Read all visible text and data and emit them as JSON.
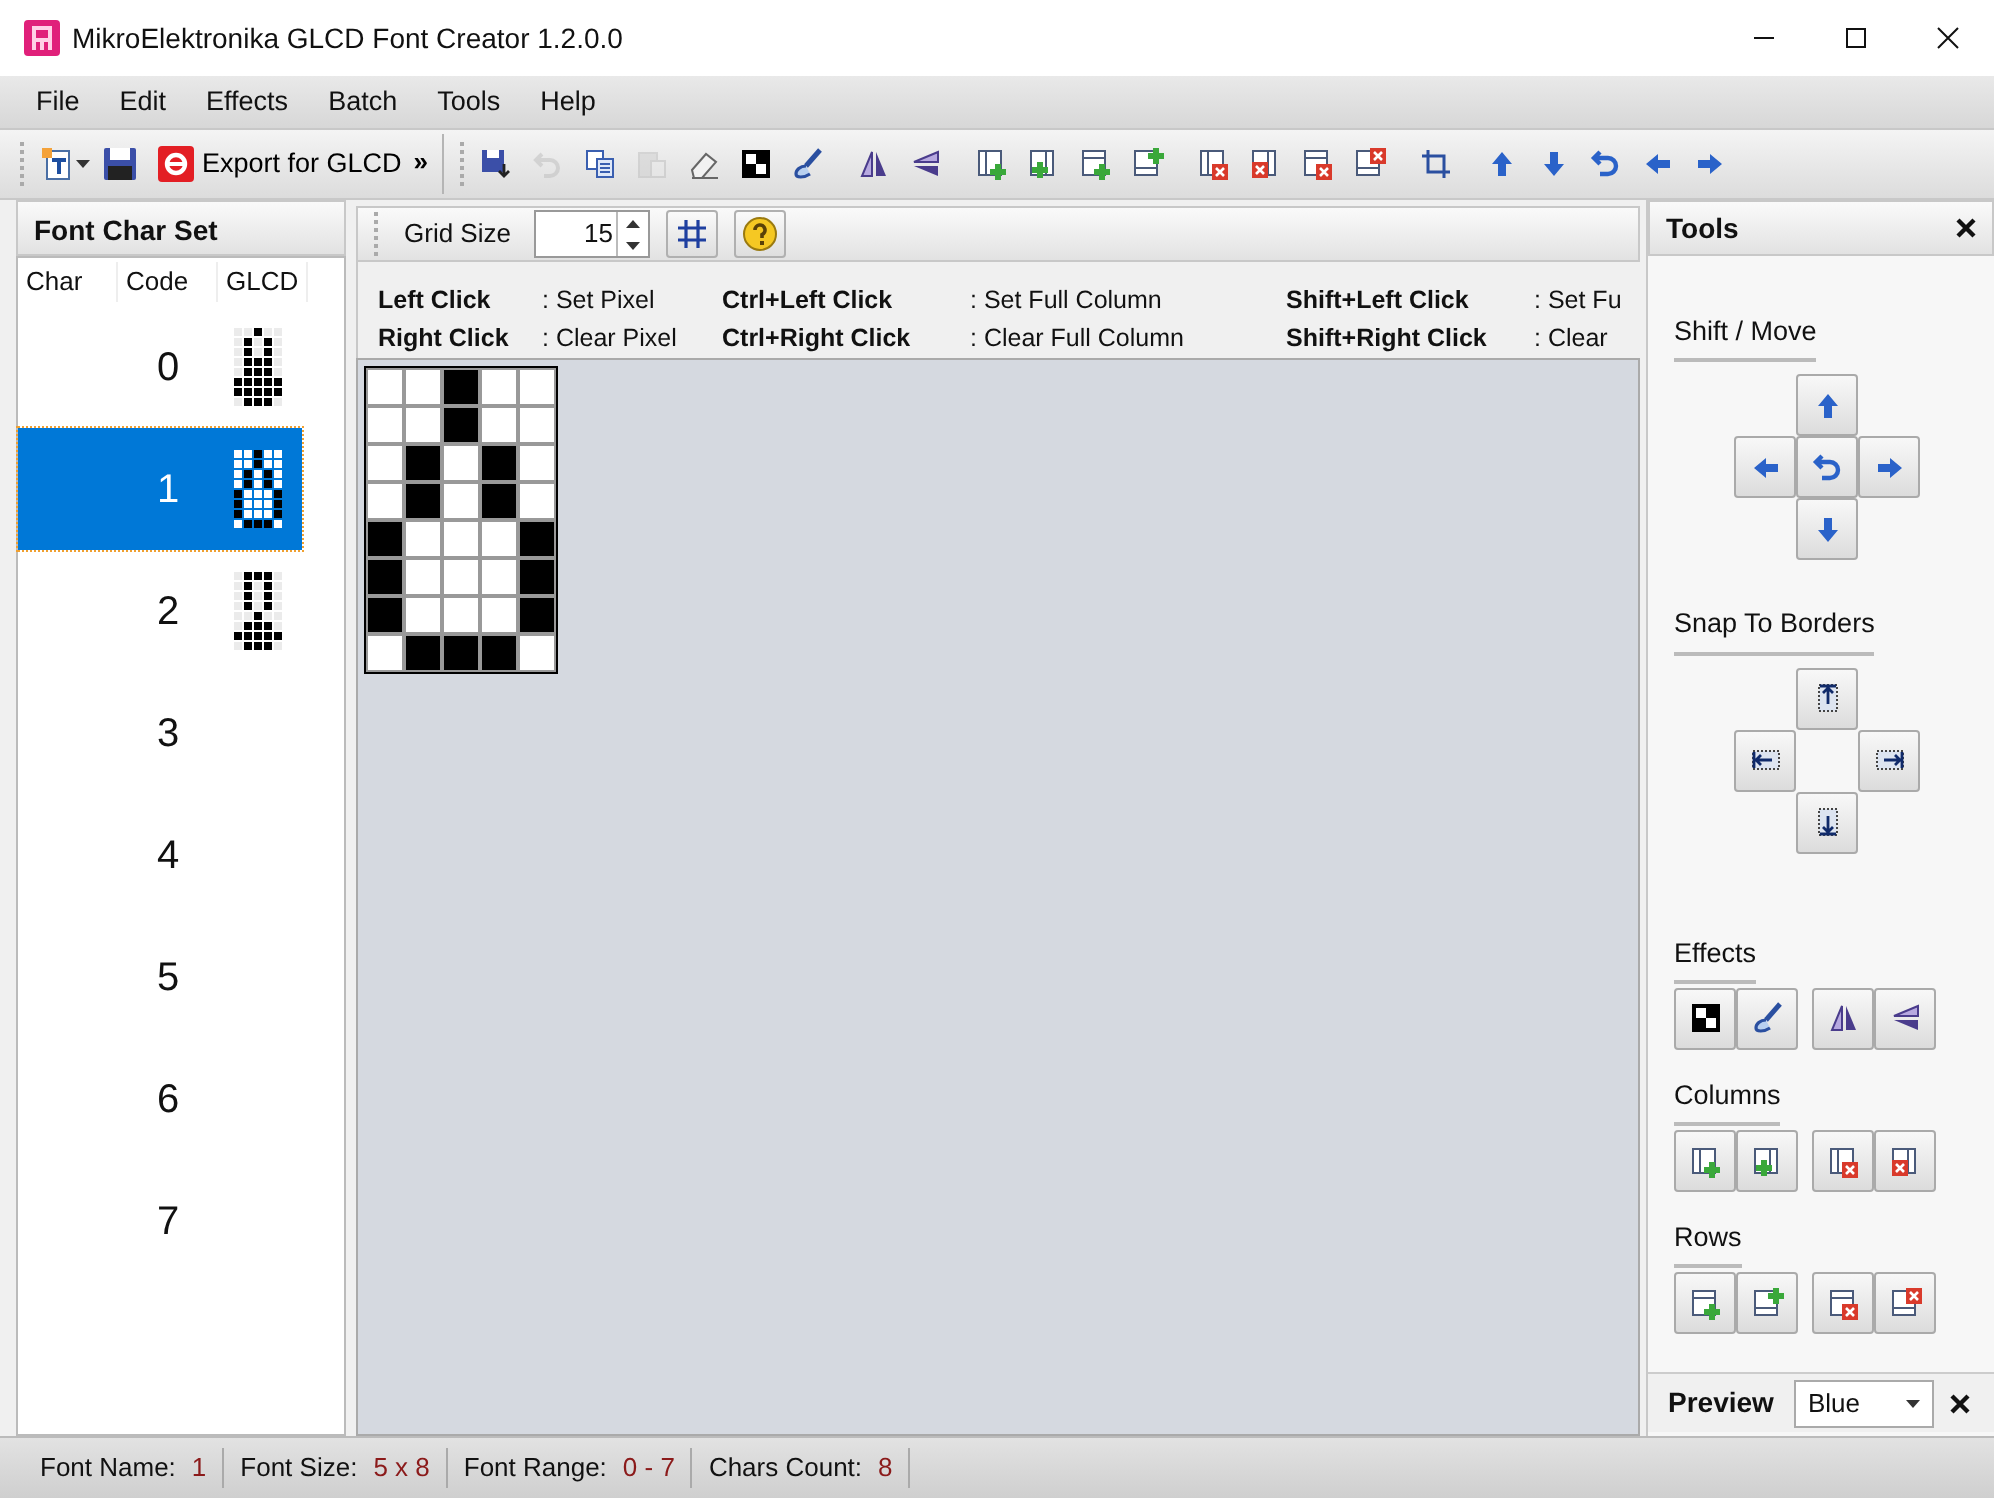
{
  "window": {
    "title": "MikroElektronika GLCD Font Creator 1.2.0.0"
  },
  "menu": [
    "File",
    "Edit",
    "Effects",
    "Batch",
    "Tools",
    "Help"
  ],
  "toolbar": {
    "export_label": "Export for GLCD",
    "overflow": "»",
    "button_groups": [
      [
        {
          "kind": "save-as",
          "disabled": false
        },
        {
          "kind": "undo",
          "disabled": true
        },
        {
          "kind": "copy",
          "disabled": false
        },
        {
          "kind": "paste",
          "disabled": true
        },
        {
          "kind": "eraser",
          "disabled": false
        },
        {
          "kind": "invert",
          "disabled": false
        },
        {
          "kind": "brush",
          "disabled": false
        }
      ],
      [
        {
          "kind": "mirror",
          "disabled": false
        },
        {
          "kind": "flip",
          "disabled": false
        }
      ],
      [
        {
          "kind": "col-add-left",
          "disabled": false
        },
        {
          "kind": "col-add-right",
          "disabled": false
        },
        {
          "kind": "row-add-bottom",
          "disabled": false
        },
        {
          "kind": "row-add-top",
          "disabled": false
        }
      ],
      [
        {
          "kind": "col-del-left",
          "disabled": false
        },
        {
          "kind": "col-del-right",
          "disabled": false
        },
        {
          "kind": "row-del-bottom",
          "disabled": false
        },
        {
          "kind": "row-del-top",
          "disabled": false
        }
      ],
      [
        {
          "kind": "crop",
          "disabled": false
        }
      ],
      [
        {
          "kind": "up",
          "disabled": false
        },
        {
          "kind": "down",
          "disabled": false
        },
        {
          "kind": "rotate",
          "disabled": false
        },
        {
          "kind": "left",
          "disabled": false
        },
        {
          "kind": "right",
          "disabled": false
        }
      ]
    ]
  },
  "charset": {
    "title": "Font Char Set",
    "columns": [
      "Char",
      "Code",
      "GLCD"
    ],
    "rows": [
      {
        "code": "0",
        "selected": false,
        "pixels": [
          [
            false,
            false,
            true,
            false,
            false
          ],
          [
            false,
            true,
            false,
            true,
            false
          ],
          [
            false,
            true,
            false,
            true,
            false
          ],
          [
            false,
            true,
            true,
            true,
            false
          ],
          [
            false,
            true,
            true,
            true,
            false
          ],
          [
            true,
            true,
            true,
            true,
            true
          ],
          [
            true,
            true,
            true,
            true,
            true
          ],
          [
            false,
            true,
            true,
            true,
            false
          ]
        ]
      },
      {
        "code": "1",
        "selected": true,
        "pixels": [
          [
            false,
            false,
            true,
            false,
            false
          ],
          [
            false,
            false,
            true,
            false,
            false
          ],
          [
            false,
            true,
            false,
            true,
            false
          ],
          [
            false,
            true,
            false,
            true,
            false
          ],
          [
            true,
            false,
            false,
            false,
            true
          ],
          [
            true,
            false,
            false,
            false,
            true
          ],
          [
            true,
            false,
            false,
            false,
            true
          ],
          [
            false,
            true,
            true,
            true,
            false
          ]
        ]
      },
      {
        "code": "2",
        "selected": false,
        "pixels": [
          [
            false,
            true,
            true,
            true,
            false
          ],
          [
            false,
            true,
            false,
            true,
            false
          ],
          [
            false,
            true,
            false,
            true,
            false
          ],
          [
            false,
            true,
            false,
            true,
            false
          ],
          [
            false,
            false,
            true,
            false,
            false
          ],
          [
            false,
            true,
            true,
            true,
            false
          ],
          [
            true,
            true,
            true,
            true,
            true
          ],
          [
            false,
            true,
            true,
            true,
            false
          ]
        ]
      },
      {
        "code": "3",
        "selected": false
      },
      {
        "code": "4",
        "selected": false
      },
      {
        "code": "5",
        "selected": false
      },
      {
        "code": "6",
        "selected": false
      },
      {
        "code": "7",
        "selected": false
      }
    ]
  },
  "editor": {
    "grid_size_label": "Grid Size",
    "grid_size": "15",
    "hints": [
      [
        {
          "key": "Left Click",
          "action": ": Set Pixel"
        },
        {
          "key": "Right Click",
          "action": ": Clear Pixel"
        }
      ],
      [
        {
          "key": "Ctrl+Left Click",
          "action": ": Set Full Column"
        },
        {
          "key": "Ctrl+Right Click",
          "action": ": Clear Full Column"
        }
      ],
      [
        {
          "key": "Shift+Left Click",
          "action": ": Set Fu"
        },
        {
          "key": "Shift+Right Click",
          "action": ": Clear"
        }
      ]
    ],
    "pixels": [
      [
        false,
        false,
        true,
        false,
        false
      ],
      [
        false,
        false,
        true,
        false,
        false
      ],
      [
        false,
        true,
        false,
        true,
        false
      ],
      [
        false,
        true,
        false,
        true,
        false
      ],
      [
        true,
        false,
        false,
        false,
        true
      ],
      [
        true,
        false,
        false,
        false,
        true
      ],
      [
        true,
        false,
        false,
        false,
        true
      ],
      [
        false,
        true,
        true,
        true,
        false
      ]
    ]
  },
  "tools": {
    "title": "Tools",
    "sections": [
      {
        "title": "Shift / Move",
        "kind": "shift"
      },
      {
        "title": "Snap To Borders",
        "kind": "snap"
      },
      {
        "title": "Effects",
        "kind": "effects"
      },
      {
        "title": "Columns",
        "kind": "columns"
      },
      {
        "title": "Rows",
        "kind": "rows"
      }
    ],
    "preview": {
      "label": "Preview",
      "value": "Blue"
    }
  },
  "status_bar": [
    {
      "label": "Font Name:",
      "value": "1"
    },
    {
      "label": "Font Size:",
      "value": "5 x 8"
    },
    {
      "label": "Font Range:",
      "value": "0 - 7"
    },
    {
      "label": "Chars Count:",
      "value": "8"
    }
  ]
}
